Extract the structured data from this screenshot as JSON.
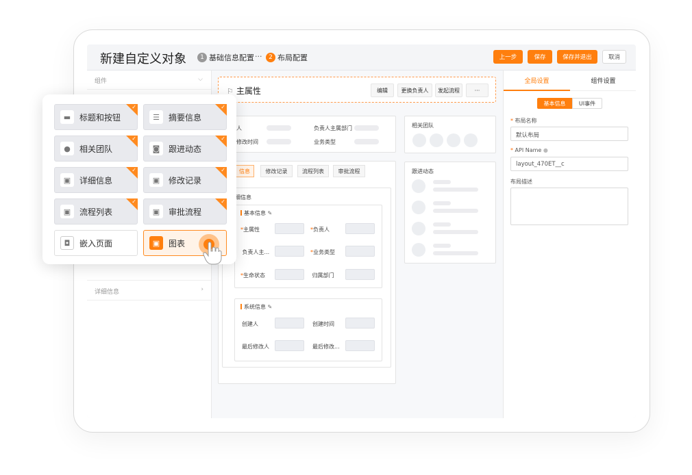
{
  "header": {
    "title": "新建自定义对象",
    "steps": [
      {
        "num": "1",
        "label": "基础信息配置",
        "color": "#999999"
      },
      {
        "num": "2",
        "label": "布局配置",
        "color": "#ff7f0e"
      }
    ],
    "step_sep": "···",
    "buttons": {
      "prev": "上一步",
      "save": "保存",
      "save_exit": "保存并退出",
      "cancel": "取消"
    }
  },
  "left_pane": {
    "header": "组件",
    "detail_row": "详细信息"
  },
  "center": {
    "main_property": "主属性",
    "actions": [
      "编辑",
      "更换负责人",
      "发起流程",
      "···"
    ],
    "summary_labels": {
      "owner_dept": "负责人主属部门",
      "modified_time": "修改时间",
      "biz_type": "业务类型",
      "owner_partial": "人"
    },
    "related_team": "相关团队",
    "follow_up": "跟进动态",
    "tabs": [
      "信息",
      "修改记录",
      "流程列表",
      "审批流程"
    ],
    "detail_title": "细信息",
    "basic_section": "基本信息",
    "basic_fields": [
      {
        "label": "主属性",
        "required": true
      },
      {
        "label": "负责人",
        "required": true
      },
      {
        "label": "负责人主...",
        "required": false
      },
      {
        "label": "业务类型",
        "required": true
      },
      {
        "label": "生命状态",
        "required": true
      },
      {
        "label": "归属部门",
        "required": false
      }
    ],
    "system_section": "系统信息",
    "system_fields": [
      "创建人",
      "创建时间",
      "最后修改人",
      "最后修改..."
    ]
  },
  "right_pane": {
    "tabs": [
      "全局设置",
      "组件设置"
    ],
    "subtabs": [
      "基本信息",
      "UI事件"
    ],
    "layout_name_label": "布局名称",
    "layout_name_value": "默认布局",
    "api_label": "API Name",
    "api_value": "layout_470ET__c",
    "desc_label": "布局描述"
  },
  "components": [
    {
      "label": "标题和按钮",
      "icon": "title-button-icon",
      "glyph": "▬",
      "checked": true
    },
    {
      "label": "摘要信息",
      "icon": "summary-icon",
      "glyph": "☰",
      "checked": true
    },
    {
      "label": "相关团队",
      "icon": "team-icon",
      "glyph": "●",
      "checked": true
    },
    {
      "label": "跟进动态",
      "icon": "follow-icon",
      "glyph": "◙",
      "checked": true
    },
    {
      "label": "详细信息",
      "icon": "detail-icon",
      "glyph": "▣",
      "checked": true
    },
    {
      "label": "修改记录",
      "icon": "record-icon",
      "glyph": "▣",
      "checked": true
    },
    {
      "label": "流程列表",
      "icon": "flow-icon",
      "glyph": "▣",
      "checked": true
    },
    {
      "label": "审批流程",
      "icon": "approval-icon",
      "glyph": "▣",
      "checked": true
    },
    {
      "label": "嵌入页面",
      "icon": "embed-icon",
      "glyph": "◘",
      "checked": false
    },
    {
      "label": "图表",
      "icon": "chart-icon",
      "glyph": "▣",
      "checked": false
    }
  ],
  "colors": {
    "accent": "#ff7f0e"
  }
}
